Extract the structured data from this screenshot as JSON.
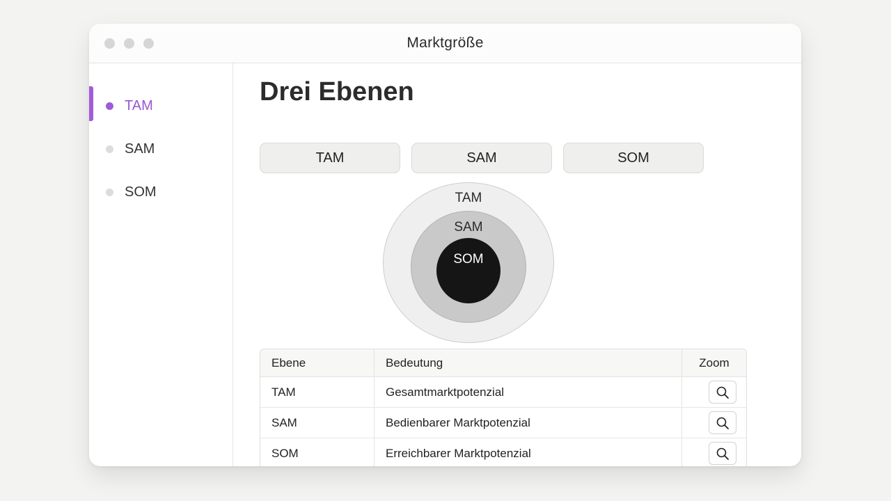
{
  "window": {
    "title": "Marktgröße"
  },
  "sidebar": {
    "items": [
      {
        "label": "TAM",
        "active": true
      },
      {
        "label": "SAM",
        "active": false
      },
      {
        "label": "SOM",
        "active": false
      }
    ]
  },
  "main": {
    "heading": "Drei Ebenen",
    "tabs": [
      {
        "label": "TAM"
      },
      {
        "label": "SAM"
      },
      {
        "label": "SOM"
      }
    ],
    "diagram": {
      "outer": "TAM",
      "middle": "SAM",
      "inner": "SOM"
    },
    "table": {
      "headers": [
        "Ebene",
        "Bedeutung",
        "Zoom"
      ],
      "rows": [
        {
          "level": "TAM",
          "meaning": "Gesamtmarktpotenzial",
          "zoom_icon": "search-icon"
        },
        {
          "level": "SAM",
          "meaning": "Bedienbarer Marktpotenzial",
          "zoom_icon": "search-icon"
        },
        {
          "level": "SOM",
          "meaning": "Erreichbarer Marktpotenzial",
          "zoom_icon": "search-icon"
        }
      ]
    }
  },
  "colors": {
    "accent": "#a25bd8",
    "inner_circle": "#151515",
    "middle_circle": "#c9c9c9",
    "outer_circle": "#efefef"
  }
}
